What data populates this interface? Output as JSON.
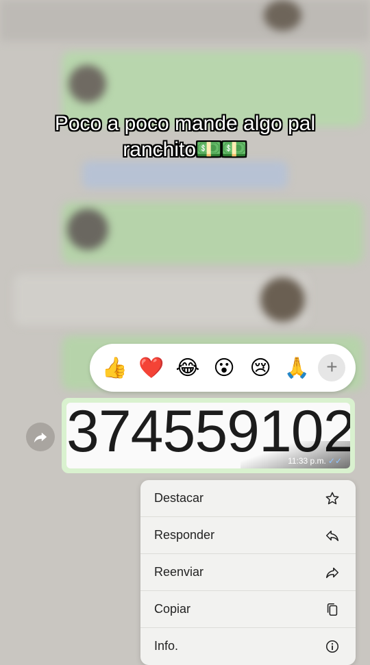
{
  "caption": {
    "line1": "Poco a poco mande algo pal",
    "line2": "ranchito💵💵"
  },
  "reactions": {
    "items": [
      "👍",
      "❤️",
      "😂",
      "😮",
      "😢",
      "🙏"
    ],
    "more_label": "+"
  },
  "message": {
    "image_text": "374559102",
    "time": "11:33 p.m.",
    "ticks": "✓✓"
  },
  "context_menu": {
    "items": [
      {
        "label": "Destacar",
        "icon": "star-icon"
      },
      {
        "label": "Responder",
        "icon": "reply-icon"
      },
      {
        "label": "Reenviar",
        "icon": "forward-icon"
      },
      {
        "label": "Copiar",
        "icon": "copy-icon"
      },
      {
        "label": "Info.",
        "icon": "info-icon"
      }
    ]
  },
  "colors": {
    "outgoing_bubble": "#d9f1cf",
    "menu_background": "#f2f2f0"
  }
}
